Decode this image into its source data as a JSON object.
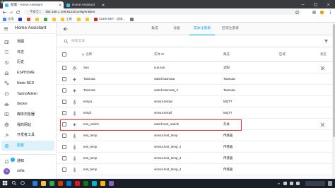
{
  "browser": {
    "tabs": [
      {
        "label": "配置 - Home Assistant",
        "active": true
      },
      {
        "label": "Home Assistant",
        "active": false
      }
    ],
    "security": "不安全 |",
    "url": "192.168.1.109:8123/config/entities",
    "bookmarks": [
      {
        "label": "应用",
        "color": "#4285f4"
      },
      {
        "label": "",
        "color": "#2932e1"
      },
      {
        "label": "",
        "color": "#e53935"
      },
      {
        "label": "",
        "color": "#fbc02d"
      },
      {
        "label": "",
        "color": "#43a047"
      },
      {
        "label": "",
        "color": "#fbc02d"
      },
      {
        "label": "工具",
        "color": "#fbc02d"
      },
      {
        "label": "",
        "color": "#fbc02d"
      },
      {
        "label": "",
        "color": "#fbc02d"
      },
      {
        "label": "CSDN.NET - 全球...",
        "color": "#c62828"
      },
      {
        "label": "",
        "color": "#757575"
      }
    ]
  },
  "sidebar": {
    "title": "Home Assistant",
    "items": [
      {
        "label": "地图",
        "icon": "map-icon"
      },
      {
        "label": "日志",
        "icon": "logbook-icon"
      },
      {
        "label": "历史",
        "icon": "history-icon"
      },
      {
        "label": "ESPHOME",
        "icon": "esphome-icon"
      },
      {
        "label": "Node-RED",
        "icon": "node-red-icon"
      },
      {
        "label": "TasmoAdmin",
        "icon": "tasmoadmin-icon"
      },
      {
        "label": "docker",
        "icon": "docker-icon"
      },
      {
        "label": "媒体浏览器",
        "icon": "media-icon"
      },
      {
        "label": "我的网站",
        "icon": "website-icon"
      },
      {
        "label": "开发者工具",
        "icon": "developer-tools-icon"
      },
      {
        "label": "配置",
        "icon": "config-icon",
        "selected": true
      }
    ],
    "notifications": {
      "label": "通知",
      "badge": "1",
      "icon": "bell-icon"
    },
    "user": {
      "name": "sofia",
      "initial": "s"
    }
  },
  "header": {
    "tabs": [
      {
        "label": "集成"
      },
      {
        "label": "设备"
      },
      {
        "label": "实体注册表",
        "active": true
      },
      {
        "label": "区域注册表"
      }
    ]
  },
  "search": {
    "placeholder": "搜索实体"
  },
  "table": {
    "columns": {
      "name": "名称",
      "entity_id": "实体 ID",
      "integration": "集成",
      "area": "区域",
      "status": "状态"
    },
    "rows": [
      {
        "icon": "sun-icon",
        "name": "Sun",
        "entity_id": "sun.sun",
        "integration": "太阳",
        "status_icon": "pencil-off-icon"
      },
      {
        "icon": "lightning-icon",
        "name": "Tasmota",
        "entity_id": "switch.tasmota",
        "integration": "Tasmota"
      },
      {
        "icon": "lightning-icon",
        "name": "Tasmota",
        "entity_id": "switch.tasmota_2",
        "integration": "Tasmota"
      },
      {
        "icon": "thermometer-icon",
        "name": "tempo",
        "entity_id": "sensor.tempo",
        "integration": "MQTT"
      },
      {
        "icon": "thermometer-icon",
        "name": "tempf",
        "entity_id": "sensor.tempf",
        "integration": "MQTT"
      },
      {
        "icon": "lightning-icon",
        "name": "test_switch",
        "entity_id": "switch.test_switch",
        "integration": "开关",
        "status_icon": "pencil-off-icon"
      },
      {
        "icon": "thermometer-icon",
        "name": "test_temp",
        "entity_id": "sensor.test_temp",
        "integration": "传感器"
      },
      {
        "icon": "thermometer-icon",
        "name": "test_temp",
        "entity_id": "sensor.test_temp_2",
        "integration": "传感器"
      },
      {
        "icon": "thermometer-icon",
        "name": "test_temp",
        "entity_id": "sensor.test_temp_3",
        "integration": "传感器"
      },
      {
        "icon": "thermometer-icon",
        "name": "test_temp",
        "entity_id": "sensor.test_temp_4",
        "integration": "传感器"
      }
    ]
  },
  "taskbar": {
    "apps": [
      {
        "icon": "edge-icon",
        "color": "#2b7cd3"
      },
      {
        "icon": "folder-icon",
        "color": "#f4c542"
      },
      {
        "icon": "chrome-icon",
        "color": "#34a853"
      },
      {
        "icon": "app-icon",
        "color": "#d83b01"
      },
      {
        "icon": "app-icon",
        "color": "#0078d4"
      },
      {
        "icon": "app-icon",
        "color": "#e81123"
      },
      {
        "icon": "app-icon",
        "color": "#107c10"
      },
      {
        "icon": "app-icon",
        "color": "#00b7c3"
      },
      {
        "icon": "app-icon",
        "color": "#ffb900"
      },
      {
        "icon": "app-icon",
        "color": "#8764b8"
      }
    ]
  },
  "colors": {
    "accent": "#03a9f4",
    "highlight_border": "#e53935"
  }
}
